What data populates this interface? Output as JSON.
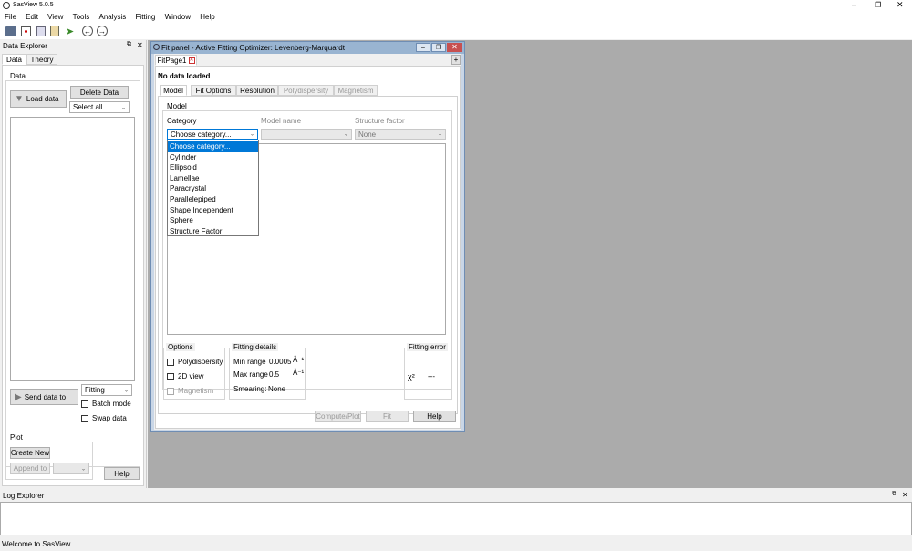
{
  "app": {
    "title": "SasView 5.0.5"
  },
  "menu": [
    "File",
    "Edit",
    "View",
    "Tools",
    "Analysis",
    "Fitting",
    "Window",
    "Help"
  ],
  "data_explorer": {
    "title": "Data Explorer",
    "tabs": [
      "Data",
      "Theory"
    ],
    "data_group": "Data",
    "load_data": "Load data",
    "delete_data": "Delete Data",
    "select_all": "Select all",
    "send_data_to": "Send data to",
    "fitting_combo": "Fitting",
    "batch_mode": "Batch mode",
    "swap_data": "Swap data",
    "plot_group": "Plot",
    "create_new": "Create New",
    "append_to": "Append to",
    "help": "Help"
  },
  "fit_panel": {
    "title": "Fit panel - Active Fitting Optimizer: Levenberg-Marquardt",
    "page_tab": "FitPage1",
    "no_data": "No data loaded",
    "tabs": [
      "Model",
      "Fit Options",
      "Resolution",
      "Polydispersity",
      "Magnetism"
    ],
    "model_group": "Model",
    "category_label": "Category",
    "model_name_label": "Model name",
    "structure_factor_label": "Structure factor",
    "category_value": "Choose category...",
    "structure_factor_value": "None",
    "category_options": [
      "Choose category...",
      "Cylinder",
      "Ellipsoid",
      "Lamellae",
      "Paracrystal",
      "Parallelepiped",
      "Shape Independent",
      "Sphere",
      "Structure Factor"
    ],
    "options_group": "Options",
    "polydispersity": "Polydispersity",
    "view_2d": "2D view",
    "magnetism": "Magnetism",
    "fitting_details_group": "Fitting details",
    "min_range_label": "Min range",
    "min_range_value": "0.0005",
    "max_range_label": "Max range",
    "max_range_value": "0.5",
    "unit": "Å⁻¹",
    "smearing_label": "Smearing:",
    "smearing_value": "None",
    "fitting_error_group": "Fitting error",
    "chi2": "χ²",
    "chi2_value": "---",
    "compute_plot": "Compute/Plot",
    "fit": "Fit",
    "help": "Help",
    "add_tab": "+"
  },
  "log_explorer": {
    "title": "Log Explorer"
  },
  "status": {
    "text": "Welcome to SasView"
  },
  "colors": {
    "workspace": "#ababab",
    "titlebar_active": "#99b4d1",
    "selection": "#0078d7",
    "close_red": "#c75050"
  }
}
